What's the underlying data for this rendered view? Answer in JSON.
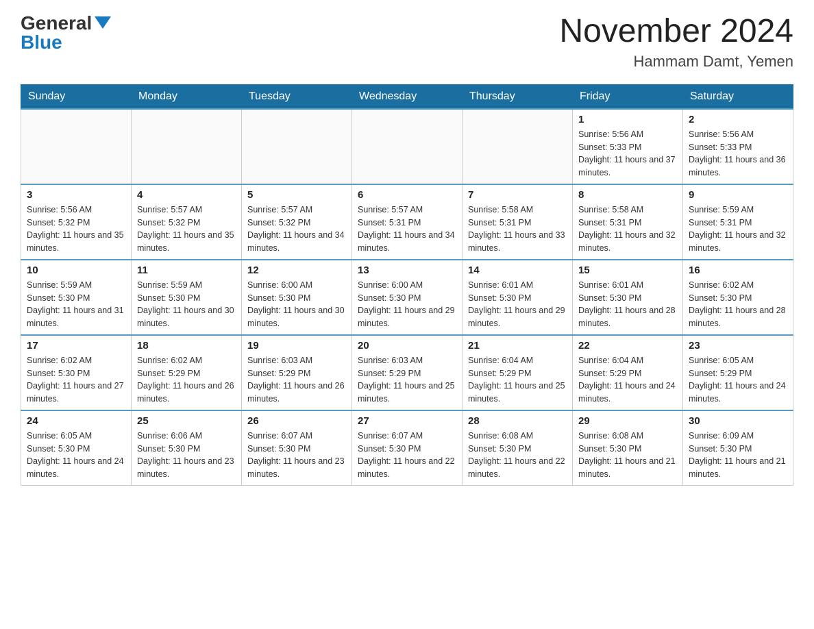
{
  "logo": {
    "general": "General",
    "blue": "Blue"
  },
  "header": {
    "month_year": "November 2024",
    "location": "Hammam Damt, Yemen"
  },
  "weekdays": [
    "Sunday",
    "Monday",
    "Tuesday",
    "Wednesday",
    "Thursday",
    "Friday",
    "Saturday"
  ],
  "weeks": [
    [
      {
        "day": "",
        "info": ""
      },
      {
        "day": "",
        "info": ""
      },
      {
        "day": "",
        "info": ""
      },
      {
        "day": "",
        "info": ""
      },
      {
        "day": "",
        "info": ""
      },
      {
        "day": "1",
        "info": "Sunrise: 5:56 AM\nSunset: 5:33 PM\nDaylight: 11 hours and 37 minutes."
      },
      {
        "day": "2",
        "info": "Sunrise: 5:56 AM\nSunset: 5:33 PM\nDaylight: 11 hours and 36 minutes."
      }
    ],
    [
      {
        "day": "3",
        "info": "Sunrise: 5:56 AM\nSunset: 5:32 PM\nDaylight: 11 hours and 35 minutes."
      },
      {
        "day": "4",
        "info": "Sunrise: 5:57 AM\nSunset: 5:32 PM\nDaylight: 11 hours and 35 minutes."
      },
      {
        "day": "5",
        "info": "Sunrise: 5:57 AM\nSunset: 5:32 PM\nDaylight: 11 hours and 34 minutes."
      },
      {
        "day": "6",
        "info": "Sunrise: 5:57 AM\nSunset: 5:31 PM\nDaylight: 11 hours and 34 minutes."
      },
      {
        "day": "7",
        "info": "Sunrise: 5:58 AM\nSunset: 5:31 PM\nDaylight: 11 hours and 33 minutes."
      },
      {
        "day": "8",
        "info": "Sunrise: 5:58 AM\nSunset: 5:31 PM\nDaylight: 11 hours and 32 minutes."
      },
      {
        "day": "9",
        "info": "Sunrise: 5:59 AM\nSunset: 5:31 PM\nDaylight: 11 hours and 32 minutes."
      }
    ],
    [
      {
        "day": "10",
        "info": "Sunrise: 5:59 AM\nSunset: 5:30 PM\nDaylight: 11 hours and 31 minutes."
      },
      {
        "day": "11",
        "info": "Sunrise: 5:59 AM\nSunset: 5:30 PM\nDaylight: 11 hours and 30 minutes."
      },
      {
        "day": "12",
        "info": "Sunrise: 6:00 AM\nSunset: 5:30 PM\nDaylight: 11 hours and 30 minutes."
      },
      {
        "day": "13",
        "info": "Sunrise: 6:00 AM\nSunset: 5:30 PM\nDaylight: 11 hours and 29 minutes."
      },
      {
        "day": "14",
        "info": "Sunrise: 6:01 AM\nSunset: 5:30 PM\nDaylight: 11 hours and 29 minutes."
      },
      {
        "day": "15",
        "info": "Sunrise: 6:01 AM\nSunset: 5:30 PM\nDaylight: 11 hours and 28 minutes."
      },
      {
        "day": "16",
        "info": "Sunrise: 6:02 AM\nSunset: 5:30 PM\nDaylight: 11 hours and 28 minutes."
      }
    ],
    [
      {
        "day": "17",
        "info": "Sunrise: 6:02 AM\nSunset: 5:30 PM\nDaylight: 11 hours and 27 minutes."
      },
      {
        "day": "18",
        "info": "Sunrise: 6:02 AM\nSunset: 5:29 PM\nDaylight: 11 hours and 26 minutes."
      },
      {
        "day": "19",
        "info": "Sunrise: 6:03 AM\nSunset: 5:29 PM\nDaylight: 11 hours and 26 minutes."
      },
      {
        "day": "20",
        "info": "Sunrise: 6:03 AM\nSunset: 5:29 PM\nDaylight: 11 hours and 25 minutes."
      },
      {
        "day": "21",
        "info": "Sunrise: 6:04 AM\nSunset: 5:29 PM\nDaylight: 11 hours and 25 minutes."
      },
      {
        "day": "22",
        "info": "Sunrise: 6:04 AM\nSunset: 5:29 PM\nDaylight: 11 hours and 24 minutes."
      },
      {
        "day": "23",
        "info": "Sunrise: 6:05 AM\nSunset: 5:29 PM\nDaylight: 11 hours and 24 minutes."
      }
    ],
    [
      {
        "day": "24",
        "info": "Sunrise: 6:05 AM\nSunset: 5:30 PM\nDaylight: 11 hours and 24 minutes."
      },
      {
        "day": "25",
        "info": "Sunrise: 6:06 AM\nSunset: 5:30 PM\nDaylight: 11 hours and 23 minutes."
      },
      {
        "day": "26",
        "info": "Sunrise: 6:07 AM\nSunset: 5:30 PM\nDaylight: 11 hours and 23 minutes."
      },
      {
        "day": "27",
        "info": "Sunrise: 6:07 AM\nSunset: 5:30 PM\nDaylight: 11 hours and 22 minutes."
      },
      {
        "day": "28",
        "info": "Sunrise: 6:08 AM\nSunset: 5:30 PM\nDaylight: 11 hours and 22 minutes."
      },
      {
        "day": "29",
        "info": "Sunrise: 6:08 AM\nSunset: 5:30 PM\nDaylight: 11 hours and 21 minutes."
      },
      {
        "day": "30",
        "info": "Sunrise: 6:09 AM\nSunset: 5:30 PM\nDaylight: 11 hours and 21 minutes."
      }
    ]
  ]
}
